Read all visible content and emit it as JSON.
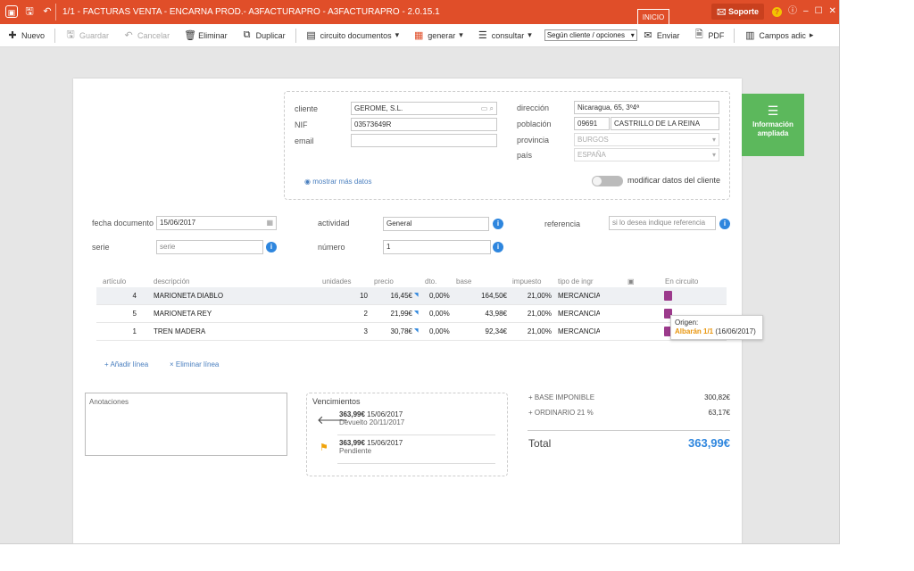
{
  "titlebar": {
    "title": "1/1 - FACTURAS VENTA - ENCARNA PROD.- A3FACTURAPRO - A3FACTURAPRO - 2.0.15.1",
    "inicio_tab": "INICIO",
    "support_label": "Soporte",
    "icons": [
      "app-icon",
      "save-icon",
      "undo-icon",
      "help-icon",
      "info-icon",
      "minimize-icon",
      "maximize-icon",
      "close-icon"
    ]
  },
  "toolbar": {
    "nuevo": "Nuevo",
    "guardar": "Guardar",
    "cancelar": "Cancelar",
    "eliminar": "Eliminar",
    "duplicar": "Duplicar",
    "circuito": "circuito documentos",
    "generar": "generar",
    "consultar": "consultar",
    "segun_select": "Según cliente / opciones",
    "enviar": "Enviar",
    "pdf": "PDF",
    "campos": "Campos adic"
  },
  "cliente": {
    "cliente_label": "cliente",
    "cliente_value": "GEROME, S.L.",
    "nif_label": "NIF",
    "nif_value": "03573649R",
    "email_label": "email",
    "email_value": "",
    "direccion_label": "dirección",
    "direccion_value": "Nicaragua, 65, 3º4ª",
    "poblacion_label": "población",
    "cp_value": "09691",
    "poblacion_value": "CASTRILLO DE LA REINA",
    "provincia_label": "provincia",
    "provincia_value": "BURGOS",
    "pais_label": "país",
    "pais_value": "ESPAÑA",
    "mostrar_mas": "mostrar más datos",
    "modificar": "modificar datos del cliente"
  },
  "info_button": {
    "line1": "Información",
    "line2": "ampliada"
  },
  "doc_fields": {
    "fecha_label": "fecha documento",
    "fecha_value": "15/06/2017",
    "serie_label": "serie",
    "serie_placeholder": "serie",
    "actividad_label": "actividad",
    "actividad_value": "General",
    "numero_label": "número",
    "numero_value": "1",
    "referencia_label": "referencia",
    "referencia_placeholder": "si lo desea indique referencia"
  },
  "table": {
    "headers": {
      "articulo": "artículo",
      "descripcion": "descripción",
      "unidades": "unidades",
      "precio": "precio",
      "dto": "dto.",
      "base": "base",
      "impuesto": "impuesto",
      "tipo": "tipo de ingr",
      "circuito": "En circuito"
    },
    "rows": [
      {
        "articulo": "4",
        "descripcion": "MARIONETA DIABLO",
        "unidades": "10",
        "precio": "16,45€",
        "dto": "0,00%",
        "base": "164,50€",
        "impuesto": "21,00%",
        "tipo": "MERCANCIAS"
      },
      {
        "articulo": "5",
        "descripcion": "MARIONETA REY",
        "unidades": "2",
        "precio": "21,99€",
        "dto": "0,00%",
        "base": "43,98€",
        "impuesto": "21,00%",
        "tipo": "MERCANCIAS"
      },
      {
        "articulo": "1",
        "descripcion": "TREN MADERA",
        "unidades": "3",
        "precio": "30,78€",
        "dto": "0,00%",
        "base": "92,34€",
        "impuesto": "21,00%",
        "tipo": "MERCANCIAS"
      }
    ],
    "tooltip": {
      "origen_label": "Origen:",
      "albaran": "Albarán 1/1",
      "date": "(16/06/2017)"
    },
    "add_line": "Añadir línea",
    "delete_line": "Eliminar línea"
  },
  "notes": {
    "label": "Anotaciones"
  },
  "vencimientos": {
    "title": "Vencimientos",
    "items": [
      {
        "amount": "363,99€",
        "date": "15/06/2017",
        "status": "Devuelto 20/11/2017"
      },
      {
        "amount": "363,99€",
        "date": "15/06/2017",
        "status": "Pendiente"
      }
    ]
  },
  "totals": {
    "base_label": "+ BASE IMPONIBLE",
    "base_value": "300,82€",
    "ordinario_label": "+ ORDINARIO 21 %",
    "ordinario_value": "63,17€",
    "total_label": "Total",
    "total_value": "363,99€"
  },
  "colors": {
    "brand": "#e04e29",
    "accent": "#2e86de",
    "green": "#5cb85c",
    "pdf": "#9c3a8c",
    "origin": "#e8950c"
  }
}
